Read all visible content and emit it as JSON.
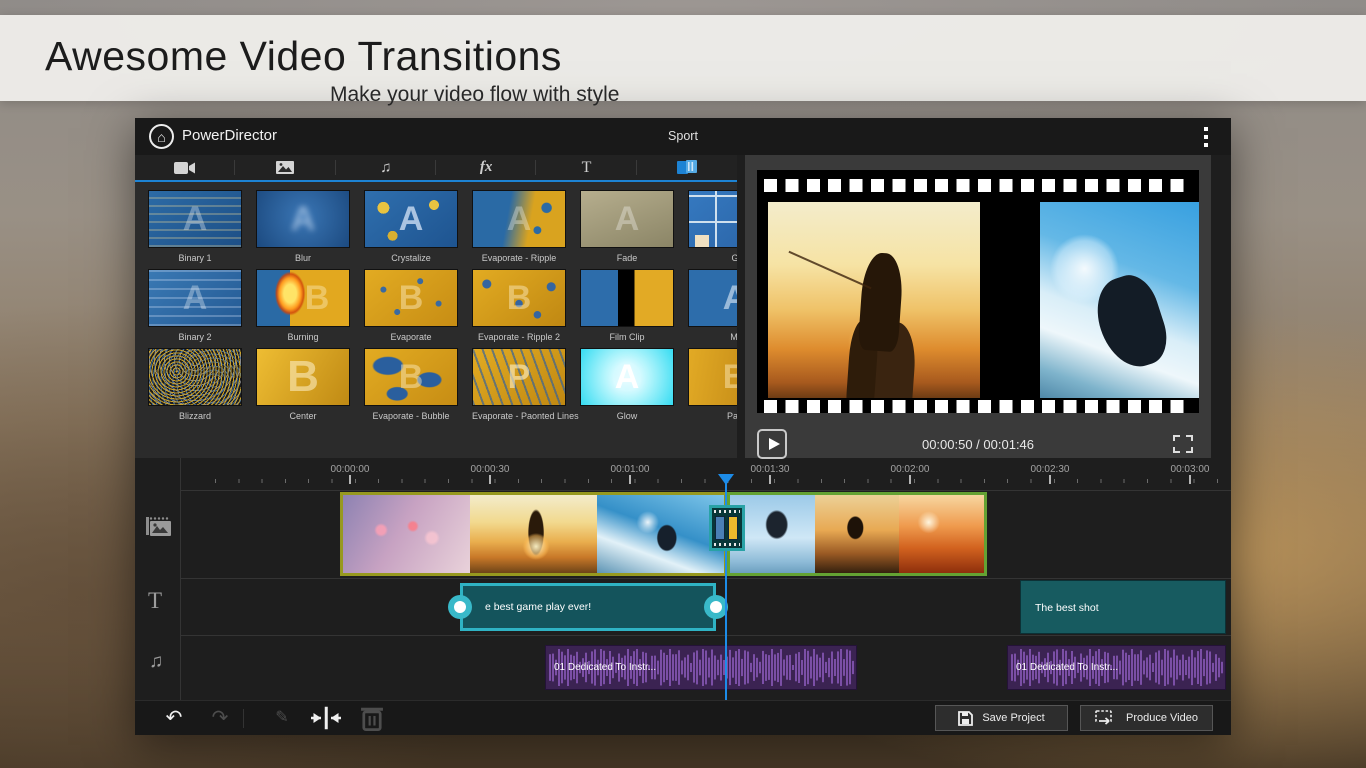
{
  "banner": {
    "title": "Awesome Video Transitions",
    "subtitle": "Make your video flow with style"
  },
  "app": {
    "title": "PowerDirector",
    "project_name": "Sport",
    "header_icons": {
      "home": "home-icon",
      "menu": "kebab-menu-icon"
    },
    "tabs": [
      {
        "id": "video",
        "icon": "video-camera-icon",
        "active": false
      },
      {
        "id": "photo",
        "icon": "photo-icon",
        "active": false
      },
      {
        "id": "music",
        "icon": "music-note-icon",
        "active": false
      },
      {
        "id": "effects",
        "icon": "fx-icon",
        "active": false
      },
      {
        "id": "text",
        "icon": "text-icon",
        "active": false
      },
      {
        "id": "transitions",
        "icon": "transitions-icon",
        "active": true
      }
    ],
    "transitions": [
      {
        "label": "Binary 1",
        "style": "t-binary1",
        "letter": "A"
      },
      {
        "label": "Blur",
        "style": "t-blur",
        "letter": "A"
      },
      {
        "label": "Crystalize",
        "style": "t-crystal",
        "letter": "A"
      },
      {
        "label": "Evaporate - Ripple",
        "style": "t-evap1",
        "letter": "A"
      },
      {
        "label": "Fade",
        "style": "t-fade",
        "letter": "A"
      },
      {
        "label": "G",
        "style": "t-grid6",
        "letter": ""
      },
      {
        "label": "Binary 2",
        "style": "t-binary2",
        "letter": "A"
      },
      {
        "label": "Burning",
        "style": "t-burning",
        "letter": "B"
      },
      {
        "label": "Evaporate",
        "style": "t-evapg",
        "letter": "B"
      },
      {
        "label": "Evaporate - Ripple 2",
        "style": "t-evapg2",
        "letter": "B"
      },
      {
        "label": "Film Clip",
        "style": "t-filmclip",
        "letter": ""
      },
      {
        "label": "Mi",
        "style": "t-mirror",
        "letter": "A"
      },
      {
        "label": "Blizzard",
        "style": "t-blizzard",
        "letter": ""
      },
      {
        "label": "Center",
        "style": "t-center",
        "letter": "B"
      },
      {
        "label": "Evaporate - Bubble",
        "style": "t-bubble",
        "letter": "B"
      },
      {
        "label": "Evaporate - Paonted Lines",
        "style": "t-painted",
        "letter": "P"
      },
      {
        "label": "Glow",
        "style": "t-glow",
        "letter": "A"
      },
      {
        "label": "Pag",
        "style": "t-page",
        "letter": "B"
      }
    ],
    "preview": {
      "timecode": "00:00:50 / 00:01:46",
      "play_icon": "play-icon",
      "fullscreen_icon": "fullscreen-icon"
    },
    "timeline": {
      "ruler_labels": [
        "00:00:00",
        "00:00:30",
        "00:01:00",
        "00:01:30",
        "00:02:00",
        "00:02:30",
        "00:03:00"
      ],
      "track_icons": [
        {
          "icon": "media-track-icon"
        },
        {
          "icon": "text-track-icon",
          "glyph": "T"
        },
        {
          "icon": "audio-track-icon",
          "glyph": "♫"
        }
      ],
      "video_clips": [
        {
          "thumbs": [
            "v-bokeh",
            "v-fisher",
            "v-surf"
          ],
          "border": "#97991f"
        },
        {
          "thumbs": [
            "v-bmx",
            "v-skate",
            "v-urban"
          ],
          "border": "#64a233"
        }
      ],
      "transition_marker": {
        "icon": "transition-clip-icon"
      },
      "text_clips": [
        {
          "label": "e best game play ever!",
          "selected": true
        },
        {
          "label": "The best shot",
          "selected": false
        }
      ],
      "audio_clips": [
        {
          "label": "01 Dedicated To Instr..."
        },
        {
          "label": "01 Dedicated To Instr..."
        }
      ]
    },
    "toolbar": {
      "undo_icon": "undo-icon",
      "redo_icon": "redo-icon",
      "edit_icon": "pencil-icon",
      "split_icon": "split-icon",
      "delete_icon": "trash-icon",
      "save_label": "Save Project",
      "produce_label": "Produce Video"
    }
  },
  "colors": {
    "accent_blue": "#1d83d4",
    "playhead_blue": "#1d8ce8",
    "selection_teal": "#2fb3c4",
    "audio_purple": "#7b4fa6",
    "clip_border_olive": "#97991f",
    "clip_border_green": "#64a233"
  }
}
